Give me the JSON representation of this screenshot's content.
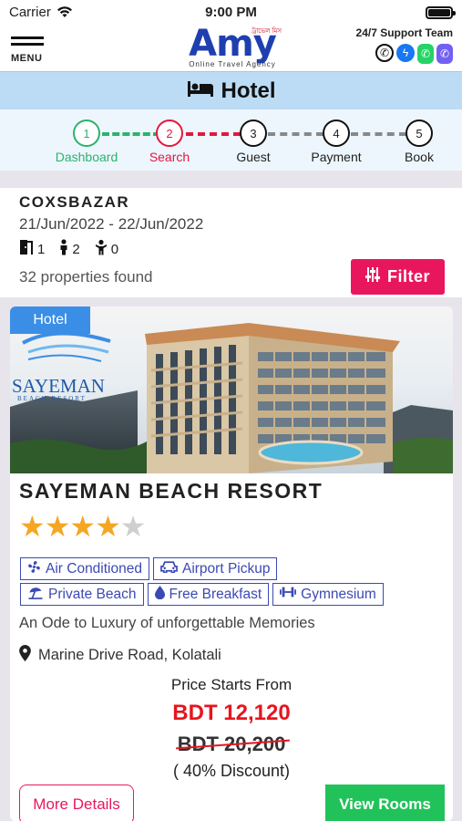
{
  "status_bar": {
    "carrier": "Carrier",
    "time": "9:00 PM"
  },
  "header": {
    "menu_label": "MENU",
    "logo_text": "Amy",
    "logo_bengali": "ট্রাভেল মিস",
    "logo_subtitle": "Online Travel Agency",
    "support_title": "24/7 Support Team",
    "support_icons": [
      "phone-icon",
      "messenger-icon",
      "whatsapp-icon",
      "viber-icon"
    ]
  },
  "page_title": "Hotel",
  "steps": [
    {
      "num": "1",
      "label": "Dashboard",
      "state": "done"
    },
    {
      "num": "2",
      "label": "Search",
      "state": "active"
    },
    {
      "num": "3",
      "label": "Guest",
      "state": "pending"
    },
    {
      "num": "4",
      "label": "Payment",
      "state": "pending"
    },
    {
      "num": "5",
      "label": "Book",
      "state": "pending"
    }
  ],
  "search": {
    "city": "COXSBAZAR",
    "dates": "21/Jun/2022 - 22/Jun/2022",
    "rooms": "1",
    "adults": "2",
    "children": "0",
    "found": "32 properties found",
    "filter_label": "Filter"
  },
  "hotel": {
    "badge": "Hotel",
    "logo_text_1": "SAYEMAN",
    "logo_text_2": "BEACH RESORT",
    "name": "SAYEMAN BEACH RESORT",
    "rating": 4,
    "rating_max": 5,
    "amenities": [
      {
        "label": "Air Conditioned",
        "icon": "fan-icon"
      },
      {
        "label": "Airport Pickup",
        "icon": "car-icon"
      },
      {
        "label": "Private Beach",
        "icon": "beach-umbrella-icon"
      },
      {
        "label": "Free Breakfast",
        "icon": "drop-icon"
      },
      {
        "label": "Gymnesium",
        "icon": "dumbbell-icon"
      }
    ],
    "tagline": "An Ode to Luxury of unforgettable Memories",
    "address": "Marine Drive Road, Kolatali",
    "price_label": "Price Starts From",
    "price": "BDT 12,120",
    "old_price": "BDT 20,200",
    "discount": "( 40% Discount)",
    "more_details_label": "More Details",
    "view_rooms_label": "View Rooms"
  },
  "colors": {
    "brand_blue": "#1f3fb0",
    "filter_pink": "#e8175d",
    "step_done": "#2db26c",
    "step_active": "#e3173e",
    "price_red": "#e8141e",
    "view_green": "#22c25a",
    "star_gold": "#f5a623"
  }
}
